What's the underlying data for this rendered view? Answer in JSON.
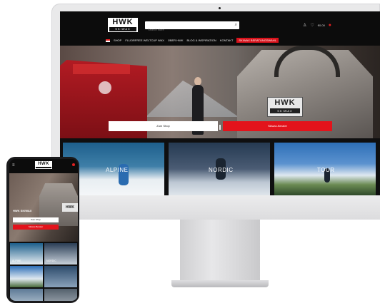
{
  "desktop": {
    "logo": {
      "text": "HWK",
      "subtext": "SKIWAX"
    },
    "search": {
      "placeholder": "Search store"
    },
    "header_icons": {
      "price": "€0.00"
    },
    "nav": {
      "items": [
        "SHOP",
        "FLUORFREE WELTCUP WAX",
        "ÜBER HWK",
        "BLOG & INSPIRATION",
        "KONTAKT"
      ],
      "highlight": "SKIWAX BERATUNGSWAHL"
    },
    "hero": {
      "waxer_logo": {
        "text": "HWK",
        "subtext": "SKIWAX"
      },
      "button_white": "Zum Shop",
      "button_red": "Skiwax-Berater"
    },
    "tiles": [
      {
        "label": "ALPINE"
      },
      {
        "label": "NORDIC"
      },
      {
        "label": "TOUR"
      }
    ]
  },
  "mobile": {
    "logo": {
      "text": "HWK"
    },
    "hero_title": "HWK SKIWAX",
    "waxer_label": "HWK",
    "button_white": "Zum Shop",
    "button_red": "Skiwax-Berater",
    "tiles": [
      "ALPINE",
      "NORDIC",
      "",
      "",
      "",
      ""
    ]
  },
  "colors": {
    "brand_red": "#e3131b",
    "header_black": "#0c0c0c"
  }
}
